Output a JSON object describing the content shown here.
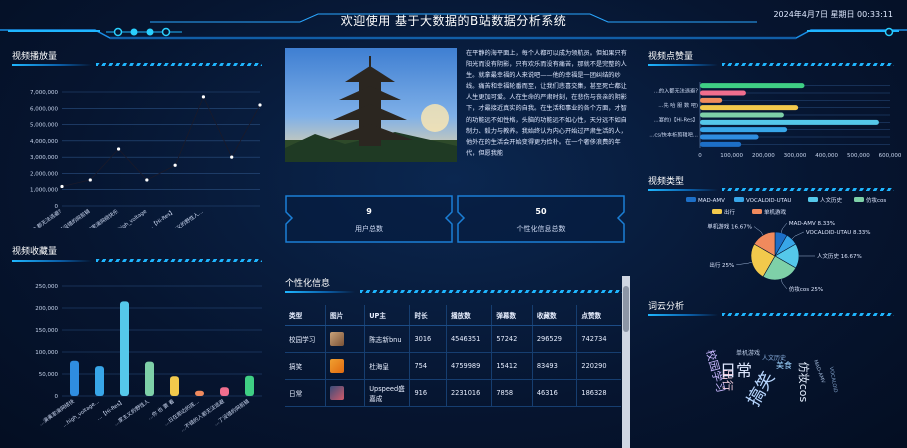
{
  "header": {
    "title": "欢迎使用 基于大数据的B站数据分析系统",
    "datetime": "2024年4月7日 星期日 00:33:11"
  },
  "colors": {
    "accent": "#1fb6ff",
    "bg": "#061530"
  },
  "panels": {
    "plays": "视频播放量",
    "favorites": "视频收藏量",
    "likes": "视频点赞量",
    "types": "视频类型",
    "wordcloud": "词云分析",
    "custom": "个性化信息"
  },
  "article": {
    "text": "在平静的海平面上，每个人都可以成为领航员。但如果只有阳光而没有阴影，只有欢乐而没有痛苦，那就不是完整的人生。就拿最幸福的人来说吧——他的幸福是一团纠结的纱线。痛苦和幸福轮番而至，让我们悲喜交集，甚至死亡都让人生更加可爱。人在生命的严肃时刻，在悲伤与丧亲的阴影下，才最接近真实的自我。在生活和事业的各个方面，才智的功能远不如性格，头脑的功能远不如心性，天分远不如自制力、毅力与教养。我始终认为内心开始过严肃生活的人，他外在的生活会开始变得更为俭朴。在一个奢侈浪费的年代，但愿我能"
  },
  "stats": [
    {
      "value": "9",
      "label": "用户总数"
    },
    {
      "value": "50",
      "label": "个性化信息总数"
    }
  ],
  "table": {
    "headers": [
      "类型",
      "图片",
      "UP主",
      "时长",
      "播放数",
      "弹幕数",
      "收藏数",
      "点赞数"
    ],
    "rows": [
      [
        "校园学习",
        "",
        "陈志新bnu",
        "3016",
        "4546351",
        "57242",
        "296529",
        "742734"
      ],
      [
        "搞笑",
        "",
        "杜海皇",
        "754",
        "4759989",
        "15412",
        "83493",
        "220290"
      ],
      [
        "日常",
        "",
        "Upspeed盛嘉成",
        "916",
        "2231016",
        "7858",
        "46316",
        "186328"
      ]
    ]
  },
  "chart_data": [
    {
      "type": "line",
      "title": "视频播放量",
      "categories": [
        "…不错的入都无法逃避?",
        "…了没错的网剪辑",
        "…多数家演网络快乐",
        "…high_voltage",
        "…【Hi-Res】",
        "…家主义的野性人…",
        "",
        ""
      ],
      "values": [
        1200000,
        1600000,
        3500000,
        1600000,
        2500000,
        6700000,
        3000000,
        6200000
      ],
      "ylim": [
        0,
        7000000
      ],
      "yticks": [
        "0",
        "1,000,000",
        "2,000,000",
        "3,000,000",
        "4,000,000",
        "5,000,000",
        "6,000,000",
        "7,000,000"
      ]
    },
    {
      "type": "bar",
      "title": "视频收藏量",
      "categories": [
        "…演奏家演网络快",
        "…high_voltage…",
        "…【Hi-Res】",
        "…家主义的野性人",
        "…你 也 要 看",
        "…日在那边的孩…",
        "…不错的入都无法逃避",
        "…了没错的网剪辑"
      ],
      "values": [
        80000,
        68000,
        215000,
        78000,
        45000,
        12000,
        20000,
        46000
      ],
      "colors": [
        "#2f8de0",
        "#38a6e8",
        "#55c8ea",
        "#7ed0a8",
        "#f2c94c",
        "#f08a5d",
        "#f06e8e",
        "#3fcf84"
      ],
      "ylim": [
        0,
        250000
      ],
      "yticks": [
        "0",
        "50,000",
        "100,000",
        "150,000",
        "200,000",
        "250,000"
      ]
    },
    {
      "type": "bar",
      "orientation": "horizontal",
      "title": "视频点赞量",
      "categories": [
        "…的入都无法逃避?",
        "…先 哈 服 数 吧)",
        "…宴的)【Hi-Res】",
        "…cs/快本析剪辑吧…"
      ],
      "values": [
        330000,
        145000,
        70000,
        310000,
        265000,
        565000,
        275000,
        185000,
        130000
      ],
      "colors": [
        "#3fcf84",
        "#f06e8e",
        "#f08a5d",
        "#f2c94c",
        "#7ed0a8",
        "#55c8ea",
        "#38a6e8",
        "#2f8de0",
        "#1d6fc7"
      ],
      "xlim": [
        0,
        600000
      ],
      "xticks": [
        "0",
        "100,000",
        "200,000",
        "300,000",
        "400,000",
        "500,000",
        "600,000"
      ]
    },
    {
      "type": "pie",
      "title": "视频类型",
      "legend": [
        "MAD-AMV",
        "VOCALOID-UTAU",
        "人文历史",
        "仿妆cos",
        "出行",
        "单机游戏"
      ],
      "slices": [
        {
          "name": "MAD-AMV",
          "label": "MAD-AMV 8.33%",
          "value": 8.33,
          "color": "#1d6fc7"
        },
        {
          "name": "VOCALOID-UTAU",
          "label": "VOCALOID-UTAU 8.33%",
          "value": 8.33,
          "color": "#38a6e8"
        },
        {
          "name": "人文历史",
          "label": "人文历史 16.67%",
          "value": 16.67,
          "color": "#55c8ea"
        },
        {
          "name": "仿妆cos",
          "label": "仿妆cos 25%",
          "value": 25,
          "color": "#7ed0a8"
        },
        {
          "name": "出行",
          "label": "出行 25%",
          "value": 25,
          "color": "#f2c94c"
        },
        {
          "name": "单机游戏",
          "label": "单机游戏 16.67%",
          "value": 16.67,
          "color": "#f08a5d"
        }
      ]
    }
  ],
  "wordcloud": [
    {
      "text": "日常",
      "size": 16,
      "color": "#dfe8ff",
      "x": 736,
      "y": 376,
      "rot": 0
    },
    {
      "text": "搞笑",
      "size": 18,
      "color": "#b7d6ff",
      "x": 766,
      "y": 392,
      "rot": -60
    },
    {
      "text": "校园学习",
      "size": 11,
      "color": "#c9b8ff",
      "x": 712,
      "y": 372,
      "rot": 75
    },
    {
      "text": "仿妆cos",
      "size": 11,
      "color": "#e6f0ff",
      "x": 800,
      "y": 382,
      "rot": 90
    },
    {
      "text": "出行",
      "size": 11,
      "color": "#ffd7e6",
      "x": 724,
      "y": 380,
      "rot": 90
    },
    {
      "text": "美食",
      "size": 8,
      "color": "#9fd4ff",
      "x": 784,
      "y": 368,
      "rot": 0
    },
    {
      "text": "人文历史",
      "size": 6,
      "color": "#8fb6e6",
      "x": 774,
      "y": 360,
      "rot": 0
    },
    {
      "text": "MAD-AMV",
      "size": 5,
      "color": "#9fb6d6",
      "x": 818,
      "y": 372,
      "rot": 70
    },
    {
      "text": "单机游戏",
      "size": 6,
      "color": "#c0d0ea",
      "x": 748,
      "y": 355,
      "rot": 0
    },
    {
      "text": "VOCALOID",
      "size": 5,
      "color": "#7f9fc7",
      "x": 832,
      "y": 380,
      "rot": 80
    }
  ]
}
